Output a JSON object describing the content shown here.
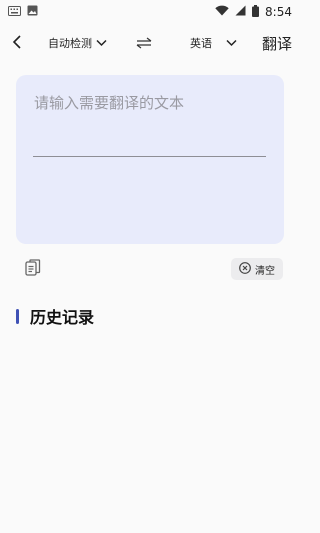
{
  "status_bar": {
    "time": "8:54",
    "icons": [
      "keyboard-icon",
      "image-icon",
      "wifi-icon",
      "cellular-signal-icon",
      "battery-icon"
    ]
  },
  "toolbar": {
    "back_icon": "chevron-left-icon",
    "source_language": "自动检测",
    "swap_icon": "swap-arrows-icon",
    "target_language": "英语",
    "dropdown_icon": "chevron-down-icon",
    "translate_label": "翻译"
  },
  "input": {
    "placeholder": "请输入需要翻译的文本",
    "value": "",
    "card_color": "#e8ebfb"
  },
  "actions": {
    "copy_icon": "paste-icon",
    "clear_icon": "clear-circle-icon",
    "clear_label": "清空"
  },
  "history": {
    "title": "历史记录",
    "accent_color": "#3f51b5",
    "items": []
  }
}
